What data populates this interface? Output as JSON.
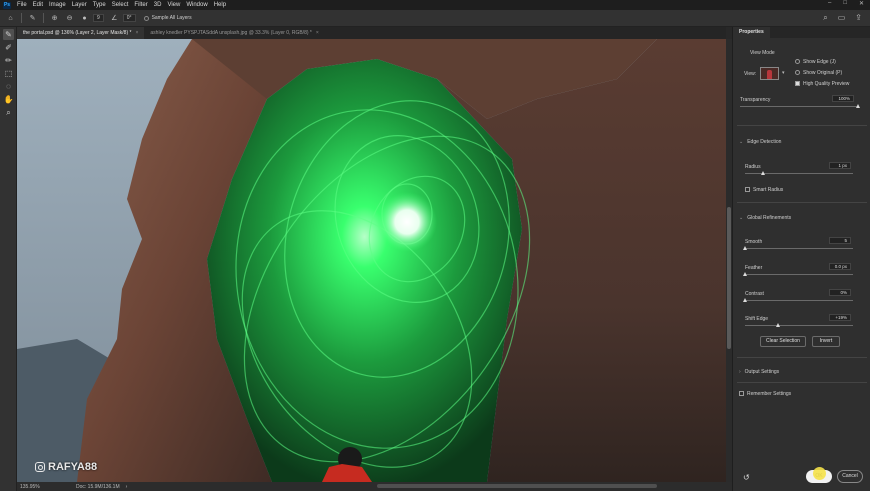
{
  "menubar": {
    "logo": "Ps",
    "items": [
      "File",
      "Edit",
      "Image",
      "Layer",
      "Type",
      "Select",
      "Filter",
      "3D",
      "View",
      "Window",
      "Help"
    ],
    "window_controls": [
      "–",
      "□",
      "✕"
    ]
  },
  "options_bar": {
    "brush_size": "9",
    "angle_field": "0°",
    "sample_all_layers": "Sample All Layers"
  },
  "tabs": [
    {
      "label": "the portal.psd @ 136% (Layer 2, Layer Mask/8) *",
      "active": true
    },
    {
      "label": "ashley knedler PYSPJTASddA unsplash.jpg @ 33.3% (Layer 0, RGB/8) *",
      "active": false
    }
  ],
  "canvas": {
    "watermark": "RAFYA88"
  },
  "status_bar": {
    "zoom": "135.95%",
    "doc": "Doc: 15.9M/136.1M",
    "arrow": "›"
  },
  "properties": {
    "tab": "Properties",
    "view_mode_label": "View Mode",
    "view_label": "View:",
    "show_edge": "Show Edge (J)",
    "show_original": "Show Original (P)",
    "high_quality": "High Quality Preview",
    "transparency_label": "Transparency",
    "transparency_value": "100%",
    "transparency_level": 1.0,
    "edge_detection": "Edge Detection",
    "radius_label": "Radius",
    "radius_value": "1 px",
    "smart_radius": "Smart Radius",
    "global_refinements": "Global Refinements",
    "smooth_label": "Smooth",
    "smooth_value": "5",
    "feather_label": "Feather",
    "feather_value": "0.0 px",
    "contrast_label": "Contrast",
    "contrast_value": "0%",
    "shift_edge_label": "Shift Edge",
    "shift_edge_value": "+19%",
    "clear_selection": "Clear Selection",
    "invert": "Invert",
    "output_settings": "Output Settings",
    "remember_settings": "Remember Settings",
    "ok": "OK",
    "cancel": "Cancel"
  },
  "colors": {
    "glow": "#39ff6e",
    "rock": "#6b4436",
    "accent": "#31a8ff"
  }
}
